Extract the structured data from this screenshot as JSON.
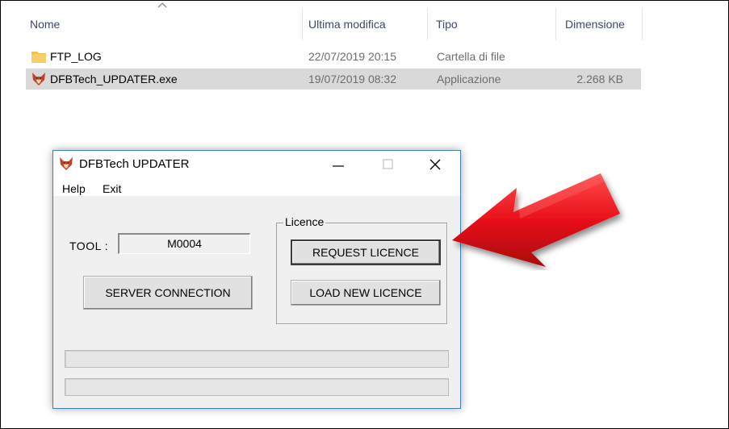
{
  "explorer": {
    "columns": [
      "Nome",
      "Ultima modifica",
      "Tipo",
      "Dimensione"
    ],
    "files": [
      {
        "name": "FTP_LOG",
        "modified": "22/07/2019 20:15",
        "type": "Cartella di file",
        "size": "",
        "icon": "folder-icon",
        "selected": false
      },
      {
        "name": "DFBTech_UPDATER.exe",
        "modified": "19/07/2019 08:32",
        "type": "Applicazione",
        "size": "2.268 KB",
        "icon": "fox-app-icon",
        "selected": true
      }
    ]
  },
  "dialog": {
    "title": "DFBTech UPDATER",
    "title_buttons": {
      "minimize": "—",
      "maximize": "☐",
      "close": "✕"
    },
    "menu": [
      "Help",
      "Exit"
    ],
    "tool_label": "TOOL :",
    "tool_value": "M0004",
    "server_button": "SERVER CONNECTION",
    "licence_group": "Licence",
    "request_button": "REQUEST LICENCE",
    "load_button": "LOAD NEW LICENCE"
  },
  "colors": {
    "selection": "#d9d9d9",
    "dialog_border": "#3d7fc0",
    "arrow": "#e8101a",
    "folder": "#f4c04e"
  }
}
